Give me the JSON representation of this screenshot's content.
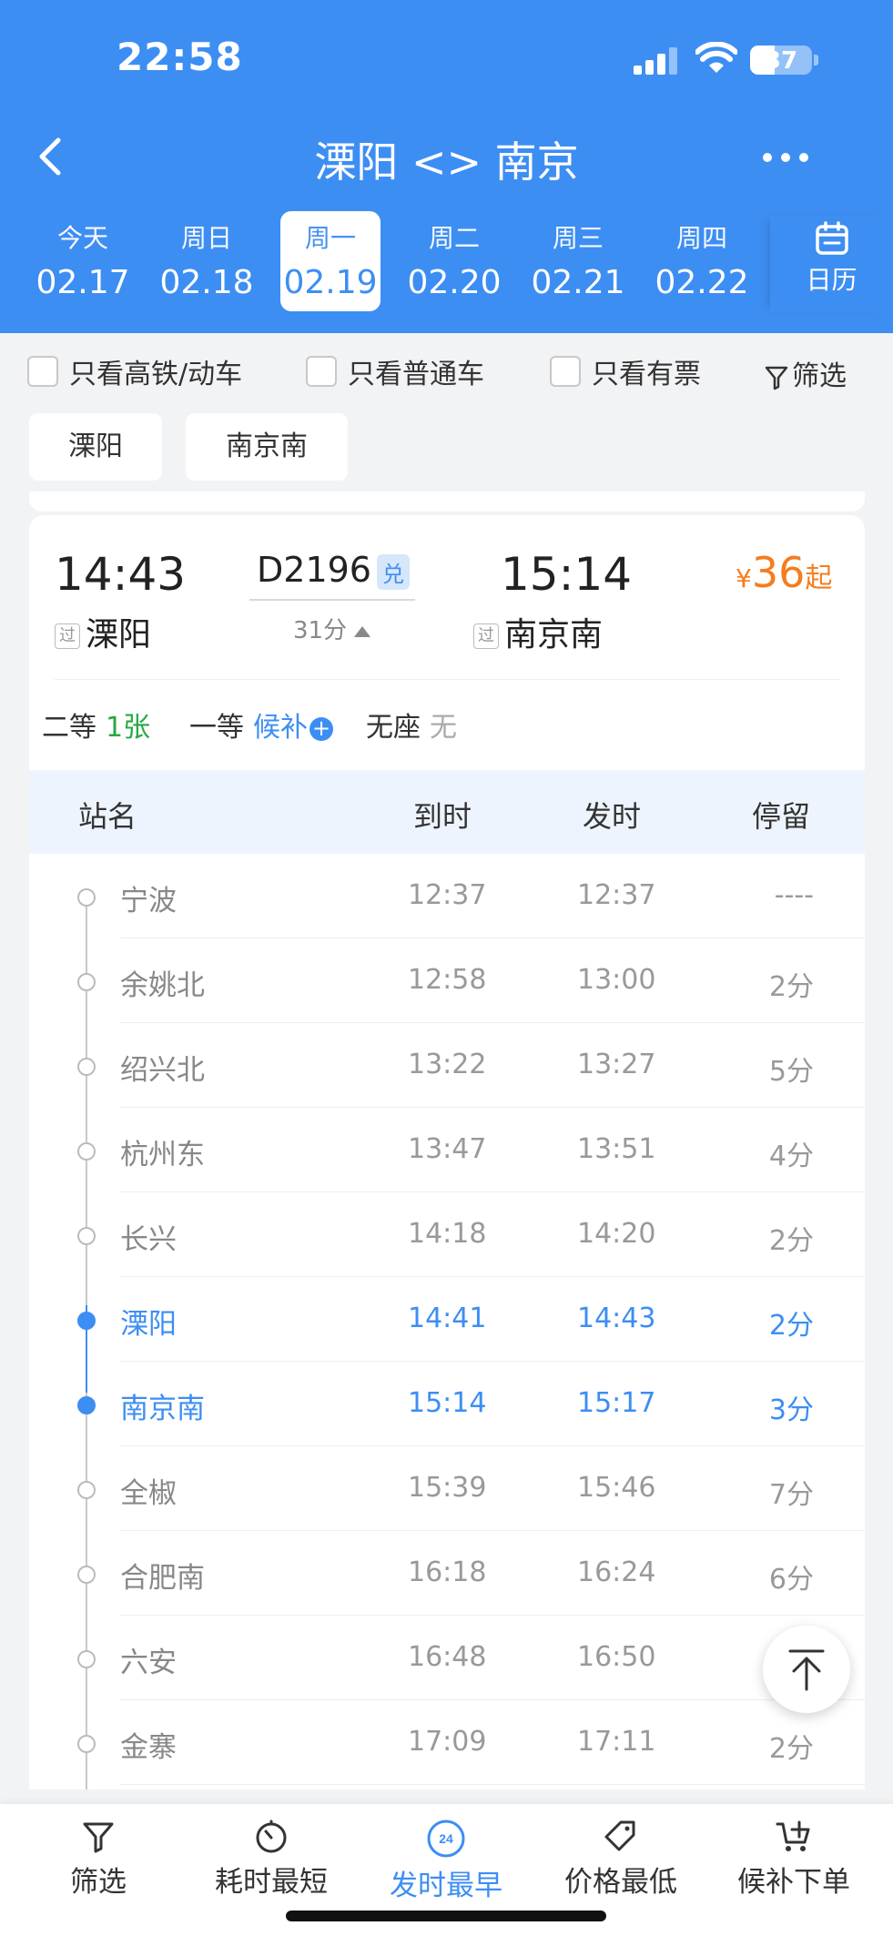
{
  "status": {
    "time": "22:58",
    "battery": "37"
  },
  "header": {
    "title": "溧阳 <> 南京"
  },
  "dates": [
    {
      "weekday": "今天",
      "date": "02.17"
    },
    {
      "weekday": "周日",
      "date": "02.18"
    },
    {
      "weekday": "周一",
      "date": "02.19"
    },
    {
      "weekday": "周二",
      "date": "02.20"
    },
    {
      "weekday": "周三",
      "date": "02.21"
    },
    {
      "weekday": "周四",
      "date": "02.22"
    }
  ],
  "calendar_label": "日历",
  "filters": {
    "high_speed": "只看高铁/动车",
    "normal": "只看普通车",
    "has_ticket": "只看有票",
    "filter_label": "筛选"
  },
  "station_chips": [
    "溧阳",
    "南京南"
  ],
  "train": {
    "dep_time": "14:43",
    "dep_station": "溧阳",
    "arr_time": "15:14",
    "arr_station": "南京南",
    "number": "D2196",
    "badge": "兑",
    "duration": "31分",
    "pass_tag": "过",
    "price_currency": "¥",
    "price": "36",
    "price_suffix": "起",
    "seats": [
      {
        "class": "二等",
        "count": "1张"
      },
      {
        "class": "一等",
        "count": "候补"
      },
      {
        "class": "无座",
        "count": "无"
      }
    ]
  },
  "stop_headers": {
    "name": "站名",
    "arrive": "到时",
    "depart": "发时",
    "stay": "停留"
  },
  "stops": [
    {
      "name": "宁波",
      "arrive": "12:37",
      "depart": "12:37",
      "stay": "----"
    },
    {
      "name": "余姚北",
      "arrive": "12:58",
      "depart": "13:00",
      "stay": "2分"
    },
    {
      "name": "绍兴北",
      "arrive": "13:22",
      "depart": "13:27",
      "stay": "5分"
    },
    {
      "name": "杭州东",
      "arrive": "13:47",
      "depart": "13:51",
      "stay": "4分"
    },
    {
      "name": "长兴",
      "arrive": "14:18",
      "depart": "14:20",
      "stay": "2分"
    },
    {
      "name": "溧阳",
      "arrive": "14:41",
      "depart": "14:43",
      "stay": "2分"
    },
    {
      "name": "南京南",
      "arrive": "15:14",
      "depart": "15:17",
      "stay": "3分"
    },
    {
      "name": "全椒",
      "arrive": "15:39",
      "depart": "15:46",
      "stay": "7分"
    },
    {
      "name": "合肥南",
      "arrive": "16:18",
      "depart": "16:24",
      "stay": "6分"
    },
    {
      "name": "六安",
      "arrive": "16:48",
      "depart": "16:50",
      "stay": ""
    },
    {
      "name": "金寨",
      "arrive": "17:09",
      "depart": "17:11",
      "stay": "2分"
    }
  ],
  "bottom_bar": {
    "filter": "筛选",
    "shortest": "耗时最短",
    "earliest": "发时最早",
    "earliest_icon_num": "24",
    "cheapest": "价格最低",
    "waitlist": "候补下单"
  },
  "colors": {
    "primary": "#3d8ef3",
    "price": "#f57c1f",
    "green": "#27a845"
  }
}
